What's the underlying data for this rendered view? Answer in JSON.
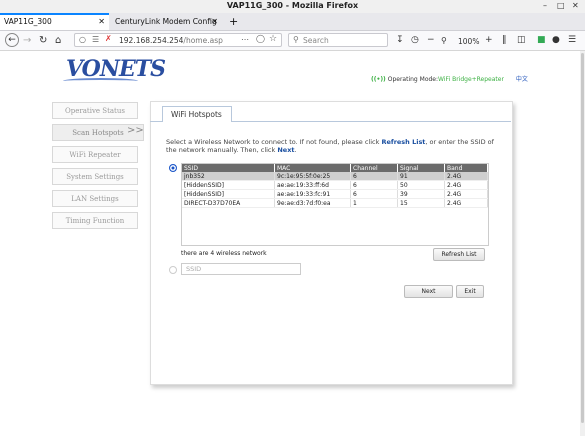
{
  "window": {
    "title": "VAP11G_300 - Mozilla Firefox",
    "minimize": "–",
    "maximize": "□",
    "close": "✕"
  },
  "tabs": [
    {
      "label": "VAP11G_300",
      "close": "✕"
    },
    {
      "label": "CenturyLink Modem Config",
      "close": "✕"
    }
  ],
  "new_tab": "+",
  "toolbar": {
    "back": "←",
    "forward": "→",
    "reload": "↻",
    "home": "⌂",
    "url_host": "192.168.254.254",
    "url_path": "/home.asp",
    "search_placeholder": "Search",
    "zoom": "100%"
  },
  "header": {
    "logo": "VONETS",
    "signal": "((•))",
    "op_mode_label": "Operating Mode:",
    "op_mode_value": "WiFi Bridge+Repeater",
    "language": "中文"
  },
  "menu": [
    {
      "label": "Operative Status"
    },
    {
      "label": "Scan Hotspots"
    },
    {
      "label": "WiFi Repeater"
    },
    {
      "label": "System Settings"
    },
    {
      "label": "LAN Settings"
    },
    {
      "label": "Timing Function"
    }
  ],
  "menu_arrow": ">>",
  "panel": {
    "tab_label": "WiFi Hotspots",
    "instr_1": "Select a Wireless Network to connect to. If not found, please click ",
    "instr_refresh": "Refresh List",
    "instr_2": ", or enter the SSID of the network manually. Then, click ",
    "instr_next": "Next",
    "instr_3": ".",
    "columns": [
      "SSID",
      "MAC",
      "Channel",
      "Signal",
      "Band"
    ],
    "rows": [
      [
        "jnb352",
        "9c:1e:95:5f:0e:25",
        "6",
        "91",
        "2.4G"
      ],
      [
        "[HiddenSSID]",
        "ae:ae:19:33:ff:6d",
        "6",
        "50",
        "2.4G"
      ],
      [
        "[HiddenSSID]",
        "ae:ae:19:33:fc:91",
        "6",
        "39",
        "2.4G"
      ],
      [
        "DIRECT-D37D70EA",
        "9e:ae:d3:7d:f0:ea",
        "1",
        "15",
        "2.4G"
      ]
    ],
    "count_text": "there are 4 wireless network",
    "refresh_button": "Refresh List",
    "ssid_placeholder": "SSID",
    "next_button": "Next",
    "exit_button": "Exit"
  }
}
